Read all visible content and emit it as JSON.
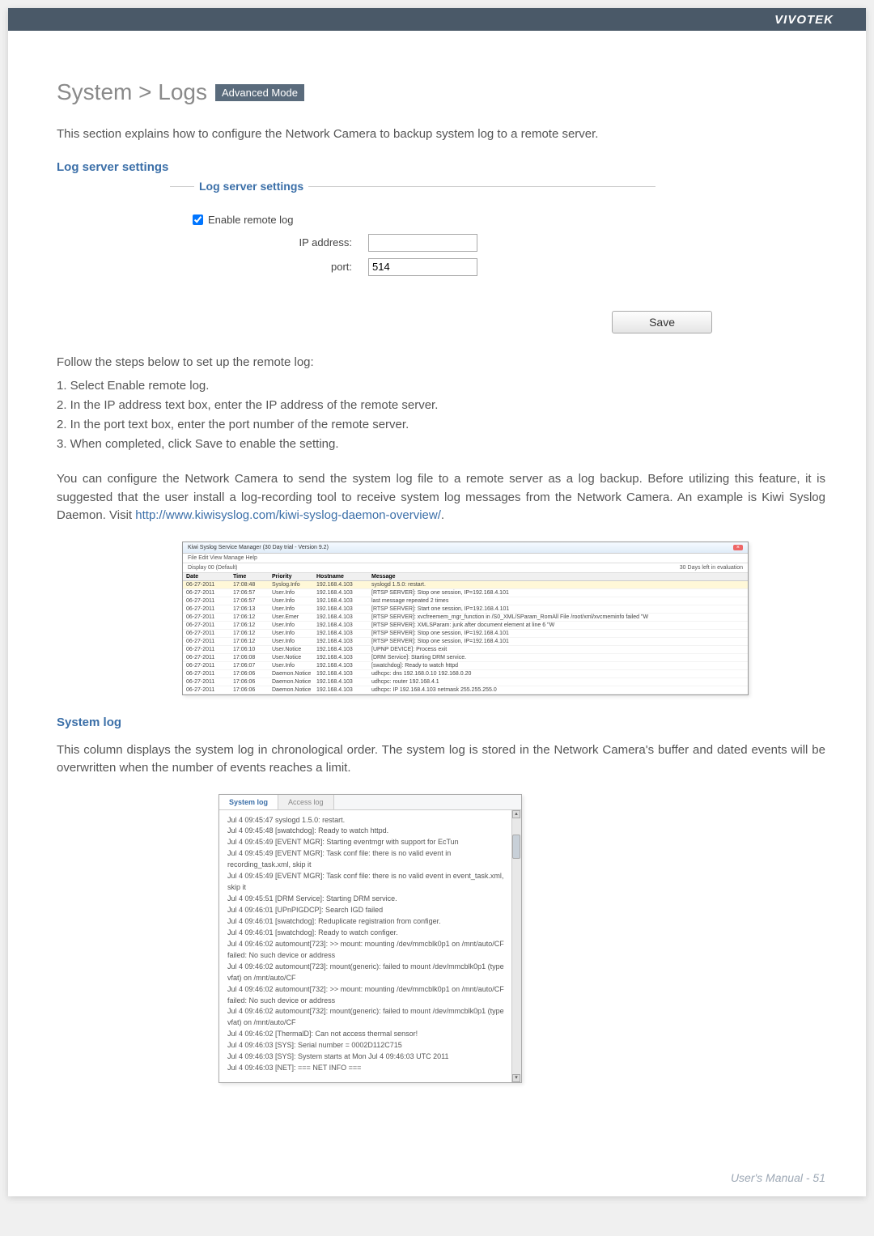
{
  "brand": "VIVOTEK",
  "title": "System > Logs",
  "badge": "Advanced Mode",
  "intro": "This section explains how to configure the Network Camera to backup system log to a remote server.",
  "section1": {
    "heading": "Log server settings",
    "legend": "Log server settings",
    "enable_label": "Enable remote log",
    "ip_label": "IP address:",
    "ip_value": "",
    "port_label": "port:",
    "port_value": "514",
    "save": "Save"
  },
  "follow_intro": "Follow the steps below to set up the remote log:",
  "steps": [
    "1. Select Enable remote log.",
    "2. In the IP address text box, enter the IP address of the remote server.",
    "2. In the port text box, enter the port number of the remote server.",
    "3. When completed, click Save to enable the setting."
  ],
  "para2_a": "You can configure the Network Camera to send the system log file to a remote server as a log backup. Before utilizing this feature, it is suggested that the user install a log-recording tool to receive system log messages from the Network Camera. An example is Kiwi Syslog Daemon. Visit ",
  "para2_link": "http://www.kiwisyslog.com/kiwi-syslog-daemon-overview/",
  "para2_b": ".",
  "kiwi": {
    "title": "Kiwi Syslog Service Manager (30 Day trial - Version 9.2)",
    "menu": "File   Edit   View   Manage   Help",
    "toolbar_left": "Display 00 (Default)",
    "toolbar_right": "30 Days left in evaluation",
    "cols": [
      "Date",
      "Time",
      "Priority",
      "Hostname",
      "Message"
    ],
    "rows": [
      [
        "06-27-2011",
        "17:08:48",
        "Syslog.Info",
        "192.168.4.103",
        "syslogd 1.5.0: restart."
      ],
      [
        "06-27-2011",
        "17:06:57",
        "User.Info",
        "192.168.4.103",
        "[RTSP SERVER]: Stop one session, IP=192.168.4.101"
      ],
      [
        "06-27-2011",
        "17:06:57",
        "User.Info",
        "192.168.4.103",
        "last message repeated 2 times"
      ],
      [
        "06-27-2011",
        "17:06:13",
        "User.Info",
        "192.168.4.103",
        "[RTSP SERVER]: Start one session, IP=192.168.4.101"
      ],
      [
        "06-27-2011",
        "17:06:12",
        "User.Emer",
        "192.168.4.103",
        "[RTSP SERVER]: xvcfreemem_mgr_function in /S0_XML/SParam_RomAll File /root/xml/xvcmeminfo failed \"W"
      ],
      [
        "06-27-2011",
        "17:06:12",
        "User.Info",
        "192.168.4.103",
        "[RTSP SERVER]: XMLSParam: junk after document element at line 6 \"W"
      ],
      [
        "06-27-2011",
        "17:06:12",
        "User.Info",
        "192.168.4.103",
        "[RTSP SERVER]: Stop one session, IP=192.168.4.101"
      ],
      [
        "06-27-2011",
        "17:06:12",
        "User.Info",
        "192.168.4.103",
        "[RTSP SERVER]: Stop one session, IP=192.168.4.101"
      ],
      [
        "06-27-2011",
        "17:06:10",
        "User.Notice",
        "192.168.4.103",
        "[UPNP DEVICE]: Process exit"
      ],
      [
        "06-27-2011",
        "17:06:08",
        "User.Notice",
        "192.168.4.103",
        "[DRM Service]: Starting DRM service."
      ],
      [
        "06-27-2011",
        "17:06:07",
        "User.Info",
        "192.168.4.103",
        "[swatchdog]: Ready to watch httpd"
      ],
      [
        "06-27-2011",
        "17:06:06",
        "Daemon.Notice",
        "192.168.4.103",
        "udhcpc: dns 192.168.0.10 192.168.0.20"
      ],
      [
        "06-27-2011",
        "17:06:06",
        "Daemon.Notice",
        "192.168.4.103",
        "udhcpc: router 192.168.4.1"
      ],
      [
        "06-27-2011",
        "17:06:06",
        "Daemon.Notice",
        "192.168.4.103",
        "udhcpc: IP 192.168.4.103 netmask 255.255.255.0"
      ]
    ]
  },
  "section2": {
    "heading": "System log",
    "para": "This column displays the system log in chronological order. The system log is stored in the Network Camera's buffer and dated events will be overwritten when the number of events reaches a limit."
  },
  "syslog": {
    "tab1": "System log",
    "tab2": "Access log",
    "lines": [
      "Jul 4 09:45:47 syslogd 1.5.0: restart.",
      "Jul 4 09:45:48 [swatchdog]: Ready to watch httpd.",
      "Jul 4 09:45:49 [EVENT MGR]: Starting eventmgr with support for EcTun",
      "Jul 4 09:45:49 [EVENT MGR]: Task conf file: there is no valid event in recording_task.xml, skip it",
      "Jul 4 09:45:49 [EVENT MGR]: Task conf file: there is no valid event in event_task.xml, skip it",
      "Jul 4 09:45:51 [DRM Service]: Starting DRM service.",
      "Jul 4 09:46:01 [UPnPIGDCP]: Search IGD failed",
      "Jul 4 09:46:01 [swatchdog]: Reduplicate registration from configer.",
      "Jul 4 09:46:01 [swatchdog]: Ready to watch configer.",
      "Jul 4 09:46:02 automount[723]: >> mount: mounting /dev/mmcblk0p1 on /mnt/auto/CF failed: No such device or address",
      "Jul 4 09:46:02 automount[723]: mount(generic): failed to mount /dev/mmcblk0p1 (type vfat) on /mnt/auto/CF",
      "Jul 4 09:46:02 automount[732]: >> mount: mounting /dev/mmcblk0p1 on /mnt/auto/CF failed: No such device or address",
      "Jul 4 09:46:02 automount[732]: mount(generic): failed to mount /dev/mmcblk0p1 (type vfat) on /mnt/auto/CF",
      "Jul 4 09:46:02 [ThermalD]: Can not access thermal sensor!",
      "Jul 4 09:46:03 [SYS]: Serial number = 0002D112C715",
      "Jul 4 09:46:03 [SYS]: System starts at Mon Jul 4 09:46:03 UTC 2011",
      "Jul 4 09:46:03 [NET]: === NET INFO ==="
    ]
  },
  "footer": "User's Manual - 51"
}
